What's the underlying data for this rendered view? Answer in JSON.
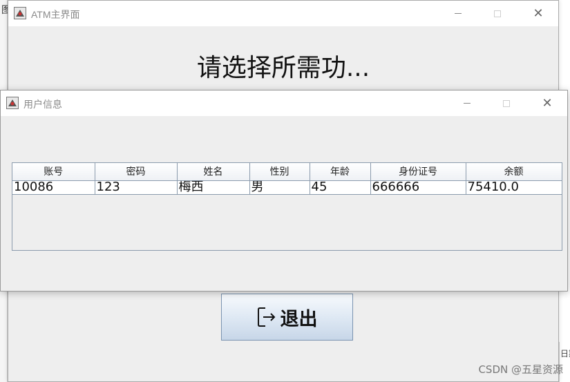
{
  "background": {
    "left_fragment": "图",
    "right_fragment": "日期"
  },
  "main_window": {
    "title": "ATM主界面",
    "heading": "请选择所需功...",
    "exit_button": {
      "label": "退出",
      "icon": "exit-door-icon"
    }
  },
  "info_window": {
    "title": "用户信息",
    "table": {
      "headers": [
        "账号",
        "密码",
        "姓名",
        "性别",
        "年龄",
        "身份证号",
        "余额"
      ],
      "rows": [
        [
          "10086",
          "123",
          "梅西",
          "男",
          "45",
          "666666",
          "75410.0"
        ]
      ]
    }
  },
  "watermark": "CSDN @五星资源",
  "colors": {
    "title_text": "#8a8a8a",
    "window_bg": "#eeeeee",
    "button_border": "#7a93b0",
    "grid_line": "#8a9aac"
  }
}
